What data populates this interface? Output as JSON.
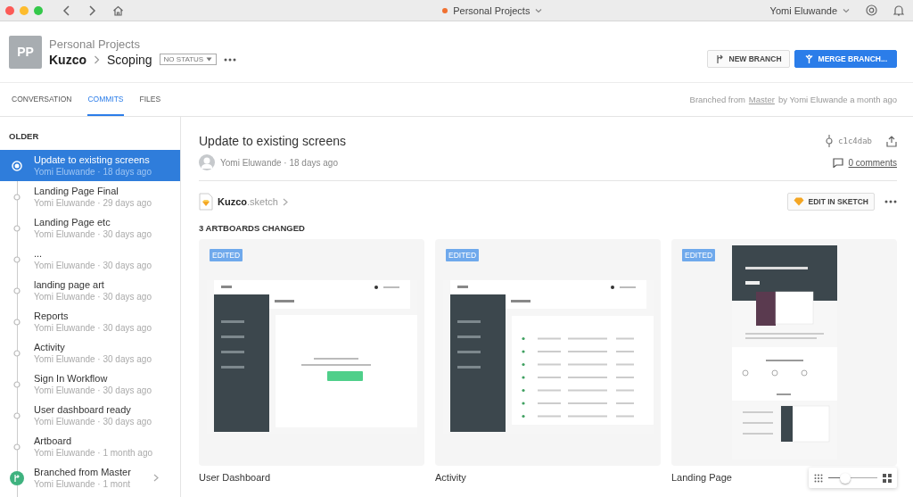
{
  "titlebar": {
    "project": "Personal Projects",
    "user": "Yomi Eluwande"
  },
  "header": {
    "avatar": "PP",
    "project": "Personal Projects",
    "breadcrumb": [
      "Kuzco",
      "Scoping"
    ],
    "status": "NO STATUS",
    "buttons": [
      {
        "label": "NEW BRANCH",
        "kind": "secondary"
      },
      {
        "label": "MERGE BRANCH...",
        "kind": "primary"
      }
    ]
  },
  "tabs": [
    {
      "label": "CONVERSATION",
      "selected": false
    },
    {
      "label": "COMMITS",
      "selected": true
    },
    {
      "label": "FILES",
      "selected": false
    }
  ],
  "branch_info": {
    "prefix": "Branched from",
    "link": "Master",
    "suffix": "by Yomi Eluwande a month ago"
  },
  "sidebar": {
    "heading": "OLDER",
    "commits": [
      {
        "title": "Update to existing screens",
        "meta": "Yomi Eluwande · 18 days ago",
        "kind": "commit",
        "selected": true
      },
      {
        "title": "Landing Page Final",
        "meta": "Yomi Eluwande · 29 days ago",
        "kind": "commit",
        "selected": false
      },
      {
        "title": "Landing Page etc",
        "meta": "Yomi Eluwande · 30 days ago",
        "kind": "commit",
        "selected": false
      },
      {
        "title": "...",
        "meta": "Yomi Eluwande · 30 days ago",
        "kind": "commit",
        "selected": false
      },
      {
        "title": "landing page art",
        "meta": "Yomi Eluwande · 30 days ago",
        "kind": "commit",
        "selected": false
      },
      {
        "title": "Reports",
        "meta": "Yomi Eluwande · 30 days ago",
        "kind": "commit",
        "selected": false
      },
      {
        "title": "Activity",
        "meta": "Yomi Eluwande · 30 days ago",
        "kind": "commit",
        "selected": false
      },
      {
        "title": "Sign In Workflow",
        "meta": "Yomi Eluwande · 30 days ago",
        "kind": "commit",
        "selected": false
      },
      {
        "title": "User dashboard ready",
        "meta": "Yomi Eluwande · 30 days ago",
        "kind": "commit",
        "selected": false
      },
      {
        "title": "Artboard",
        "meta": "Yomi Eluwande · 1 month ago",
        "kind": "commit",
        "selected": false
      },
      {
        "title": "Branched from Master",
        "meta": "Yomi Eluwande · 1 mont",
        "kind": "branch",
        "selected": false
      }
    ]
  },
  "detail": {
    "title": "Update to existing screens",
    "author": "Yomi Eluwande · 18 days ago",
    "hash": "c1c4dab",
    "comments": "0 comments",
    "file": {
      "name": "Kuzco",
      "ext": ".sketch"
    },
    "edit_button": "EDIT IN SKETCH",
    "artboards_heading": "3 ARTBOARDS CHANGED",
    "artboards": [
      {
        "name": "User Dashboard",
        "badge": "EDITED",
        "kind": "dashboard"
      },
      {
        "name": "Activity",
        "badge": "EDITED",
        "kind": "table"
      },
      {
        "name": "Landing Page",
        "badge": "EDITED",
        "kind": "landing"
      }
    ],
    "zoom": {
      "level": 0.35
    }
  }
}
